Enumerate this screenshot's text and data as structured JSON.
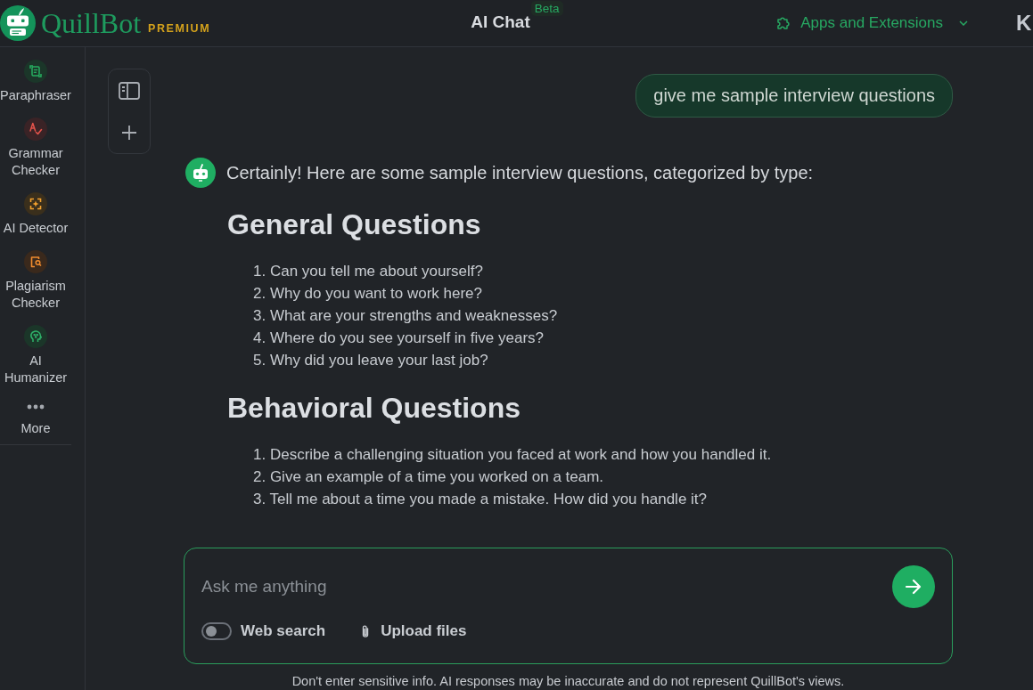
{
  "header": {
    "brand": "QuillBot",
    "plan": "PREMIUM",
    "title": "AI Chat",
    "title_badge": "Beta",
    "apps_menu": "Apps and Extensions",
    "user_initial": "K"
  },
  "sidebar": {
    "items": [
      {
        "label": "Paraphraser"
      },
      {
        "label": "Grammar Checker"
      },
      {
        "label": "AI Detector"
      },
      {
        "label": "Plagiarism Checker"
      },
      {
        "label": "AI Humanizer"
      },
      {
        "label": "More"
      }
    ]
  },
  "chat": {
    "messages": [
      {
        "kind": "user",
        "text": "give me sample interview questions"
      },
      {
        "kind": "assistant",
        "intro": "Certainly! Here are some sample interview questions, categorized by type:",
        "sections": [
          {
            "heading": "General Questions",
            "items": [
              "1. Can you tell me about yourself?",
              "2. Why do you want to work here?",
              "3. What are your strengths and weaknesses?",
              "4. Where do you see yourself in five years?",
              "5. Why did you leave your last job?"
            ]
          },
          {
            "heading": "Behavioral Questions",
            "items": [
              "1. Describe a challenging situation you faced at work and how you handled it.",
              "2. Give an example of a time you worked on a team.",
              "3. Tell me about a time you made a mistake. How did you handle it?"
            ]
          }
        ]
      }
    ]
  },
  "composer": {
    "placeholder": "Ask me anything",
    "web_search": {
      "label": "Web search",
      "on": false
    },
    "upload": {
      "label": "Upload files"
    }
  },
  "disclaimer": "Don't enter sensitive info. AI responses may be inaccurate and do not represent QuillBot's views."
}
